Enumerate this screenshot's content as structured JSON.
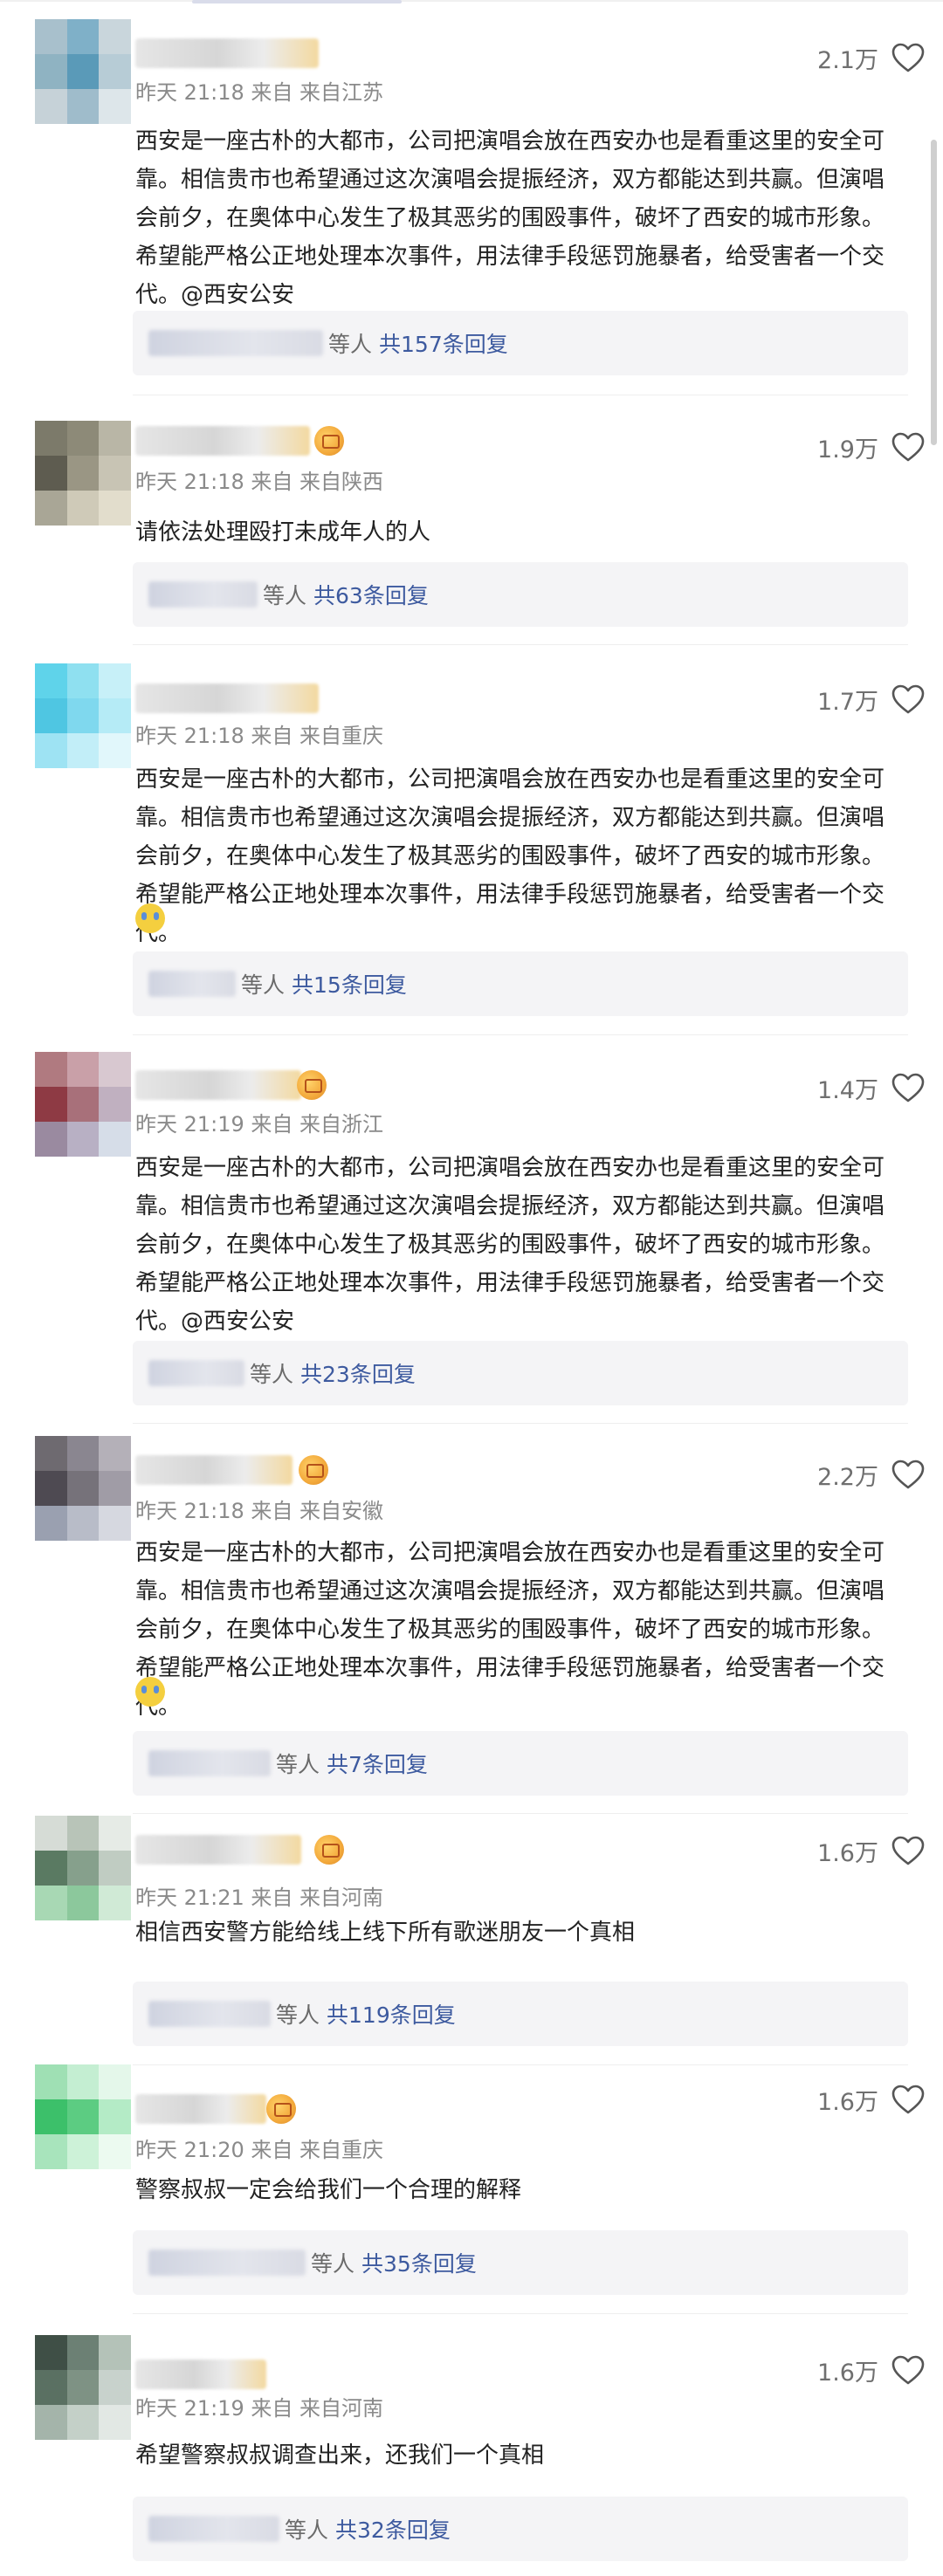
{
  "comments": [
    {
      "meta": "昨天 21:18 来自 来自江苏",
      "likes": "2.1万",
      "text": "西安是一座古朴的大都市，公司把演唱会放在西安办也是看重这里的安全可靠。相信贵市也希望通过这次演唱会提振经济，双方都能达到共赢。但演唱会前夕，在奥体中心发生了极其恶劣的围殴事件，破坏了西安的城市形象。希望能严格公正地处理本次事件，用法律手段惩罚施暴者，给受害者一个交代。@西安公安",
      "reply_deng": "等人",
      "reply_total": "共157条回复",
      "avatar_colors": [
        "#a8c0cc",
        "#7fb0c8",
        "#c9d6dc",
        "#8fb3c2",
        "#5a9ab8",
        "#b7ccd6",
        "#c6d2d8",
        "#9fbccb",
        "#dde6ea"
      ]
    },
    {
      "meta": "昨天 21:18 来自 来自陕西",
      "likes": "1.9万",
      "text": "请依法处理殴打未成年人的人",
      "reply_deng": "等人",
      "reply_total": "共63条回复",
      "avatar_colors": [
        "#7c7a6a",
        "#8d8a78",
        "#b9b6a6",
        "#5e5c50",
        "#9a9684",
        "#c8c4b4",
        "#a9a696",
        "#cfcab8",
        "#e2ddcc"
      ]
    },
    {
      "meta": "昨天 21:18 来自 来自重庆",
      "likes": "1.7万",
      "text": "西安是一座古朴的大都市，公司把演唱会放在西安办也是看重这里的安全可靠。相信贵市也希望通过这次演唱会提振经济，双方都能达到共赢。但演唱会前夕，在奥体中心发生了极其恶劣的围殴事件，破坏了西安的城市形象。希望能严格公正地处理本次事件，用法律手段惩罚施暴者，给受害者一个交代。",
      "reply_deng": "等人",
      "reply_total": "共15条回复",
      "avatar_colors": [
        "#5fd3ea",
        "#8fe0f0",
        "#c7f0f8",
        "#4fc6e2",
        "#7fd8ee",
        "#b5ebf6",
        "#9ee3f3",
        "#c2eef8",
        "#e1f7fb"
      ]
    },
    {
      "meta": "昨天 21:19 来自 来自浙江",
      "likes": "1.4万",
      "text": "西安是一座古朴的大都市，公司把演唱会放在西安办也是看重这里的安全可靠。相信贵市也希望通过这次演唱会提振经济，双方都能达到共赢。但演唱会前夕，在奥体中心发生了极其恶劣的围殴事件，破坏了西安的城市形象。希望能严格公正地处理本次事件，用法律手段惩罚施暴者，给受害者一个交代。@西安公安",
      "reply_deng": "等人",
      "reply_total": "共23条回复",
      "avatar_colors": [
        "#b07a80",
        "#c9a0a8",
        "#d8c8d0",
        "#8e3a44",
        "#a8707a",
        "#c0b0c0",
        "#9a8aa0",
        "#b8b0c4",
        "#d6dde8"
      ]
    },
    {
      "meta": "昨天 21:18 来自 来自安徽",
      "likes": "2.2万",
      "text": "西安是一座古朴的大都市，公司把演唱会放在西安办也是看重这里的安全可靠。相信贵市也希望通过这次演唱会提振经济，双方都能达到共赢。但演唱会前夕，在奥体中心发生了极其恶劣的围殴事件，破坏了西安的城市形象。希望能严格公正地处理本次事件，用法律手段惩罚施暴者，给受害者一个交代。",
      "reply_deng": "等人",
      "reply_total": "共7条回复",
      "avatar_colors": [
        "#6e6a70",
        "#8a8690",
        "#b4b0b8",
        "#4e4a52",
        "#76727a",
        "#a09ca6",
        "#9aa0b0",
        "#b8bcc8",
        "#d6d8e0"
      ]
    },
    {
      "meta": "昨天 21:21 来自 来自河南",
      "likes": "1.6万",
      "text": "相信西安警方能给线上线下所有歌迷朋友一个真相",
      "reply_deng": "等人",
      "reply_total": "共119条回复",
      "avatar_colors": [
        "#d6dcd6",
        "#b8c4b8",
        "#e6ebe6",
        "#5a7a62",
        "#86a08c",
        "#c0ccc2",
        "#a8d8b4",
        "#8cc89c",
        "#d0ead6"
      ]
    },
    {
      "meta": "昨天 21:20 来自 来自重庆",
      "likes": "1.6万",
      "text": "警察叔叔一定会给我们一个合理的解释",
      "reply_deng": "等人",
      "reply_total": "共35条回复",
      "avatar_colors": [
        "#9fe0b4",
        "#c4eed2",
        "#e4f7ea",
        "#3cc06a",
        "#5ccc82",
        "#b4ebc6",
        "#a8e4bc",
        "#cdf2d8",
        "#ecfaf0"
      ]
    },
    {
      "meta": "昨天 21:19 来自 来自河南",
      "likes": "1.6万",
      "text": "希望警察叔叔调查出来，还我们一个真相",
      "reply_deng": "等人",
      "reply_total": "共32条回复",
      "avatar_colors": [
        "#3f4f46",
        "#6c8074",
        "#b4c2b8",
        "#5a7062",
        "#7e9284",
        "#c8d2cc",
        "#a4b4aa",
        "#c4d0c8",
        "#e2e8e4"
      ]
    }
  ]
}
